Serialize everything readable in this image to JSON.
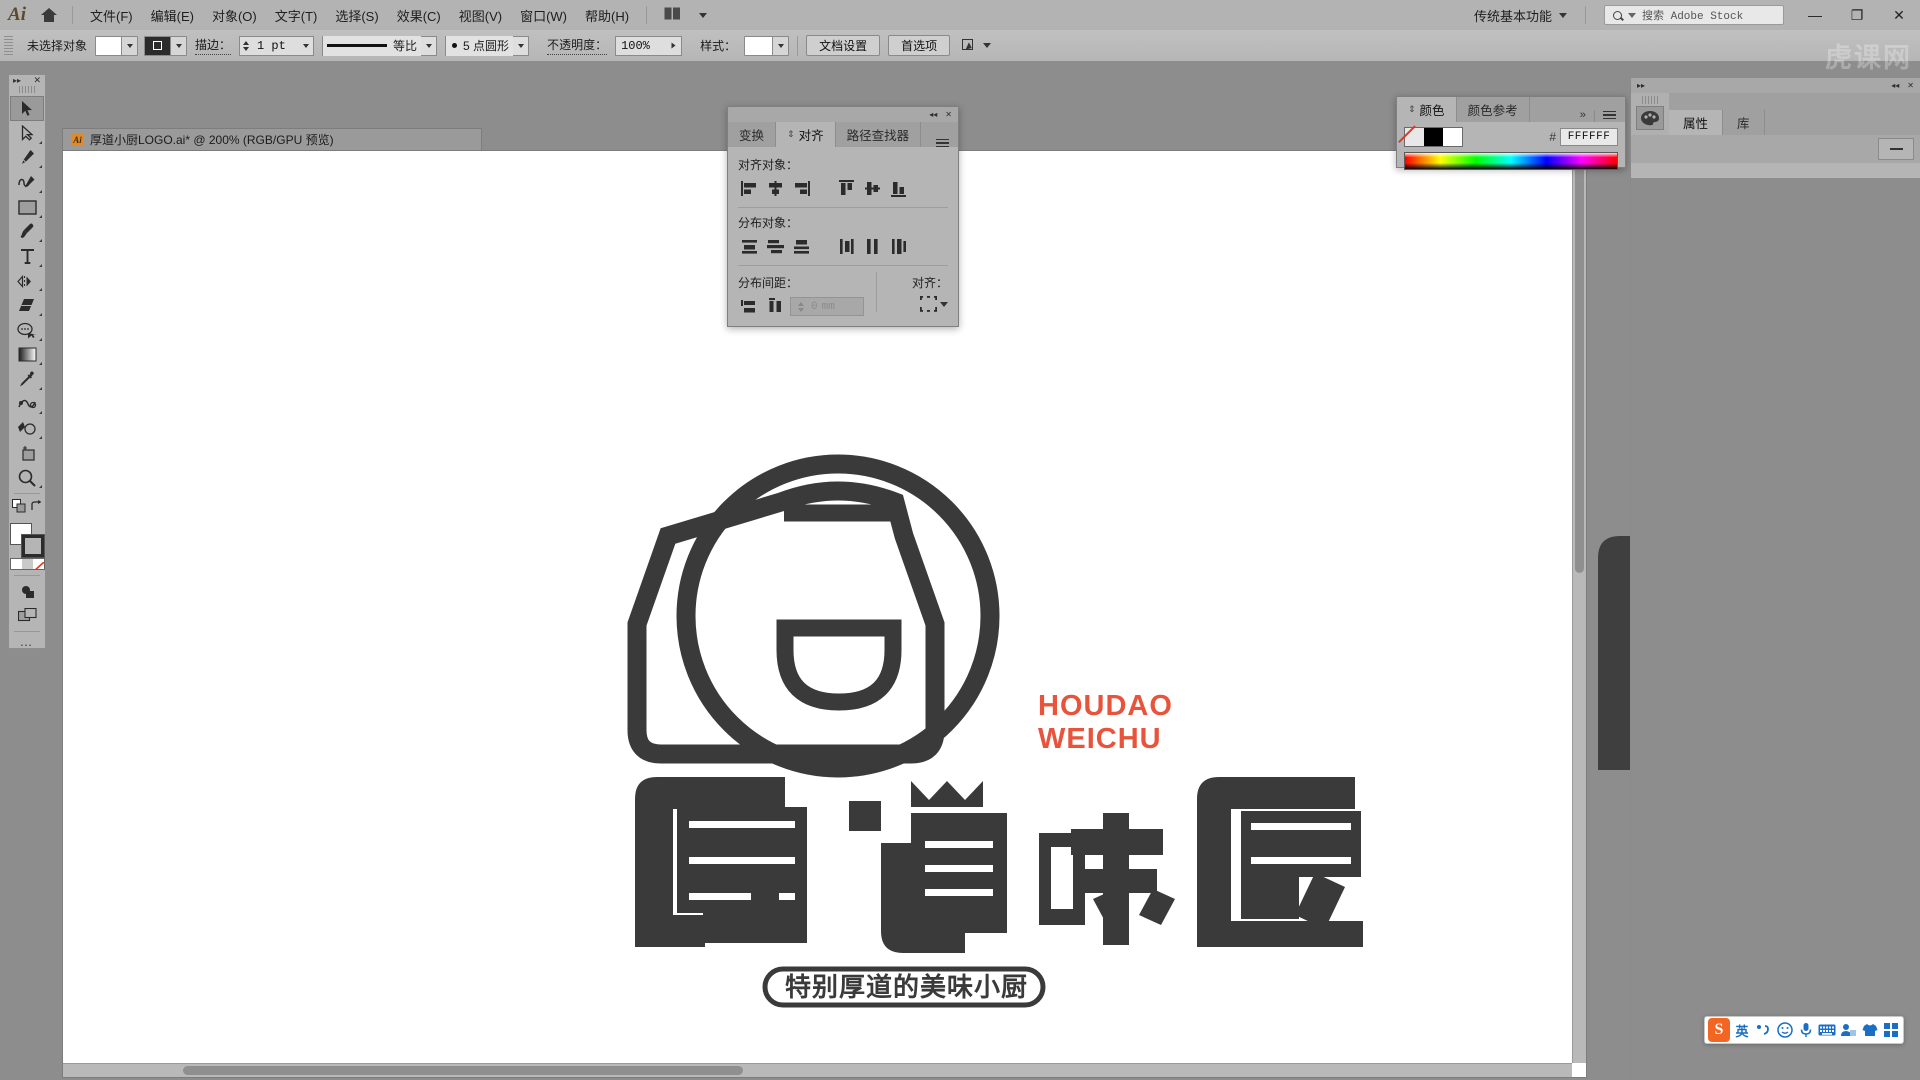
{
  "app": {
    "logo": "Ai",
    "home_icon": "home-icon"
  },
  "menubar": {
    "items": [
      {
        "label": "文件(F)"
      },
      {
        "label": "编辑(E)"
      },
      {
        "label": "对象(O)"
      },
      {
        "label": "文字(T)"
      },
      {
        "label": "选择(S)"
      },
      {
        "label": "效果(C)"
      },
      {
        "label": "视图(V)"
      },
      {
        "label": "窗口(W)"
      },
      {
        "label": "帮助(H)"
      }
    ],
    "workspace": "传统基本功能",
    "search_placeholder": "搜索 Adobe Stock",
    "window_controls": {
      "minimize": "—",
      "restore": "❐",
      "close": "✕"
    }
  },
  "controlbar": {
    "selection_status": "未选择对象",
    "fill_swatch": "#FFFFFF",
    "stroke_label": "描边：",
    "stroke_weight": "1 pt",
    "stroke_profile": "等比",
    "brush_def": "5 点圆形",
    "opacity_label": "不透明度：",
    "opacity_value": "100%",
    "style_label": "样式：",
    "doc_setup_button": "文档设置",
    "preferences_button": "首选项",
    "arrange_icon": "arrange-documents-icon"
  },
  "watermark": "虎课网",
  "toolbar": {
    "tools": [
      {
        "name": "selection-tool",
        "selected": true
      },
      {
        "name": "direct-selection-tool",
        "selected": false
      },
      {
        "name": "pen-tool",
        "selected": false
      },
      {
        "name": "curvature-tool",
        "selected": false
      },
      {
        "name": "rectangle-tool",
        "selected": false
      },
      {
        "name": "paintbrush-tool",
        "selected": false
      },
      {
        "name": "type-tool",
        "selected": false
      },
      {
        "name": "reflect-tool",
        "selected": false
      },
      {
        "name": "eraser-tool",
        "selected": false
      },
      {
        "name": "shaper-tool",
        "selected": false
      },
      {
        "name": "gradient-tool",
        "selected": false
      },
      {
        "name": "eyedropper-tool",
        "selected": false
      },
      {
        "name": "blend-tool",
        "selected": false
      },
      {
        "name": "shape-builder-tool",
        "selected": false
      },
      {
        "name": "artboard-tool",
        "selected": false
      },
      {
        "name": "zoom-tool",
        "selected": false
      }
    ],
    "fill_color": "#FFFFFF",
    "stroke_color": "#2B2B2B",
    "edit_toolbar": "…"
  },
  "document": {
    "tab_title": "厚道小厨LOGO.ai* @ 200% (RGB/GPU 预览)",
    "zoom": "200%",
    "color_mode": "RGB/GPU 预览",
    "file_icon": "ai-file-icon"
  },
  "artwork": {
    "brand_cn": "厚道味厨",
    "brand_en_line1": "HOUDAO",
    "brand_en_line2": "WEICHU",
    "tagline": "特别厚道的美味小厨",
    "accent_color": "#E8543B",
    "ink_color": "#3A3A3A",
    "emblem": "apron-in-circle-icon"
  },
  "align_panel": {
    "window_collapse": "◂◂",
    "window_close": "✕",
    "tabs": [
      {
        "label": "变换",
        "active": false
      },
      {
        "label": "对齐",
        "active": true
      },
      {
        "label": "路径查找器",
        "active": false
      }
    ],
    "menu_icon": "panel-menu-icon",
    "align_objects_label": "对齐对象：",
    "align_objects_buttons": [
      "align-left-icon",
      "align-horizontal-center-icon",
      "align-right-icon",
      "align-top-icon",
      "align-vertical-center-icon",
      "align-bottom-icon"
    ],
    "distribute_objects_label": "分布对象：",
    "distribute_objects_buttons": [
      "distribute-top-icon",
      "distribute-vertical-center-icon",
      "distribute-bottom-icon",
      "distribute-left-icon",
      "distribute-horizontal-center-icon",
      "distribute-right-icon"
    ],
    "distribute_spacing_label": "分布间距：",
    "distribute_spacing_buttons": [
      "vertical-distribute-space-icon",
      "horizontal-distribute-space-icon"
    ],
    "spacing_value": "0",
    "spacing_unit": "mm",
    "align_to_label": "对齐：",
    "align_to_icon": "align-to-selection-icon"
  },
  "color_panel": {
    "window_collapse": "»",
    "tabs": [
      {
        "label": "颜色",
        "active": true
      },
      {
        "label": "颜色参考",
        "active": false
      }
    ],
    "menu_icon": "panel-menu-icon",
    "swatches": [
      "none-swatch",
      "black-swatch",
      "white-swatch"
    ],
    "hash": "#",
    "hex_value": "FFFFFF",
    "spectrum": "color-spectrum-ramp"
  },
  "properties_panel": {
    "expand_icon": "▸▸",
    "collapse_icon": "◂◂",
    "close_icon": "✕",
    "dock_icon": "swatches-palette-icon",
    "tabs": [
      {
        "label": "属性",
        "active": true
      },
      {
        "label": "库",
        "active": false
      }
    ],
    "minimize_icon": "minimize-icon"
  },
  "ime": {
    "logo": "S",
    "mode": "英",
    "items": [
      "punctuation-icon",
      "emoji-icon",
      "voice-input-icon",
      "soft-keyboard-icon",
      "user-icon",
      "skin-icon",
      "toolbox-icon"
    ]
  }
}
